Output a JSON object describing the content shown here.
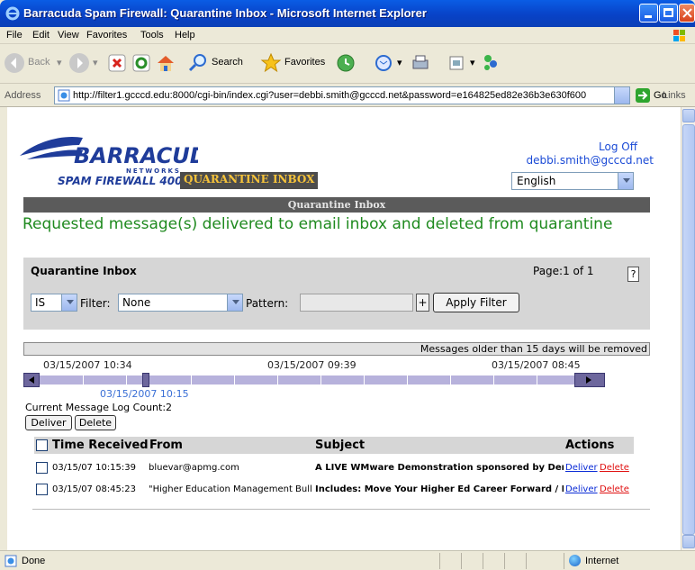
{
  "window": {
    "title": "Barracuda Spam Firewall: Quarantine Inbox - Microsoft Internet Explorer"
  },
  "menu": [
    "File",
    "Edit",
    "View",
    "Favorites",
    "Tools",
    "Help"
  ],
  "toolbar": {
    "back": "Back",
    "search": "Search",
    "favorites": "Favorites"
  },
  "address": {
    "label": "Address",
    "url": "http://filter1.gcccd.edu:8000/cgi-bin/index.cgi?user=debbi.smith@gcccd.net&password=e164825ed82e36b3e630f600",
    "go": "Go",
    "links": "Links"
  },
  "page": {
    "logo": {
      "brand": "BARRACUDA",
      "networks": "NETWORKS",
      "product": "SPAM FIREWALL 400"
    },
    "log_off": "Log Off",
    "user_email": "debbi.smith@gcccd.net",
    "tab": "QUARANTINE INBOX",
    "language": "English",
    "header": "Quarantine Inbox",
    "message": "Requested message(s) delivered to email inbox and deleted from quarantine",
    "filter": {
      "title": "Quarantine Inbox",
      "page": "Page:1 of 1",
      "help": "?",
      "operator": "IS",
      "filter_label": "Filter:",
      "filter_value": "None",
      "pattern_label": "Pattern:",
      "plus": "+",
      "apply": "Apply Filter"
    },
    "older_notice": "Messages older than 15 days will be removed",
    "timeline": {
      "left_date": "03/15/2007 10:34",
      "mid_date": "03/15/2007 09:39",
      "right_date": "03/15/2007 08:45",
      "marker_date": "03/15/2007 10:15"
    },
    "log_count": "Current Message Log Count:2",
    "buttons": {
      "deliver": "Deliver",
      "delete": "Delete"
    },
    "table": {
      "headers": {
        "time": "Time Received",
        "from": "From",
        "subject": "Subject",
        "actions": "Actions"
      },
      "rows": [
        {
          "time": "03/15/07 10:15:39",
          "from": "bluevar@apmg.com",
          "subject": "A LIVE WMware Demonstration sponsored by Dempsey",
          "deliver": "Deliver",
          "delete": "Delete"
        },
        {
          "time": "03/15/07 08:45:23",
          "from": "\"Higher Education Management Bull",
          "subject": "Includes: Move Your Higher Ed Career Forward / Profes",
          "deliver": "Deliver",
          "delete": "Delete"
        }
      ]
    }
  },
  "status": {
    "left": "Done",
    "zone": "Internet"
  },
  "colors": {
    "titlebar": "#0842c7",
    "message_green": "#1f8a1f",
    "tab_gold": "#f6c33a",
    "link_blue": "#0a2bd6",
    "delete_red": "#e01010",
    "timeline": "#b7b2dc"
  }
}
